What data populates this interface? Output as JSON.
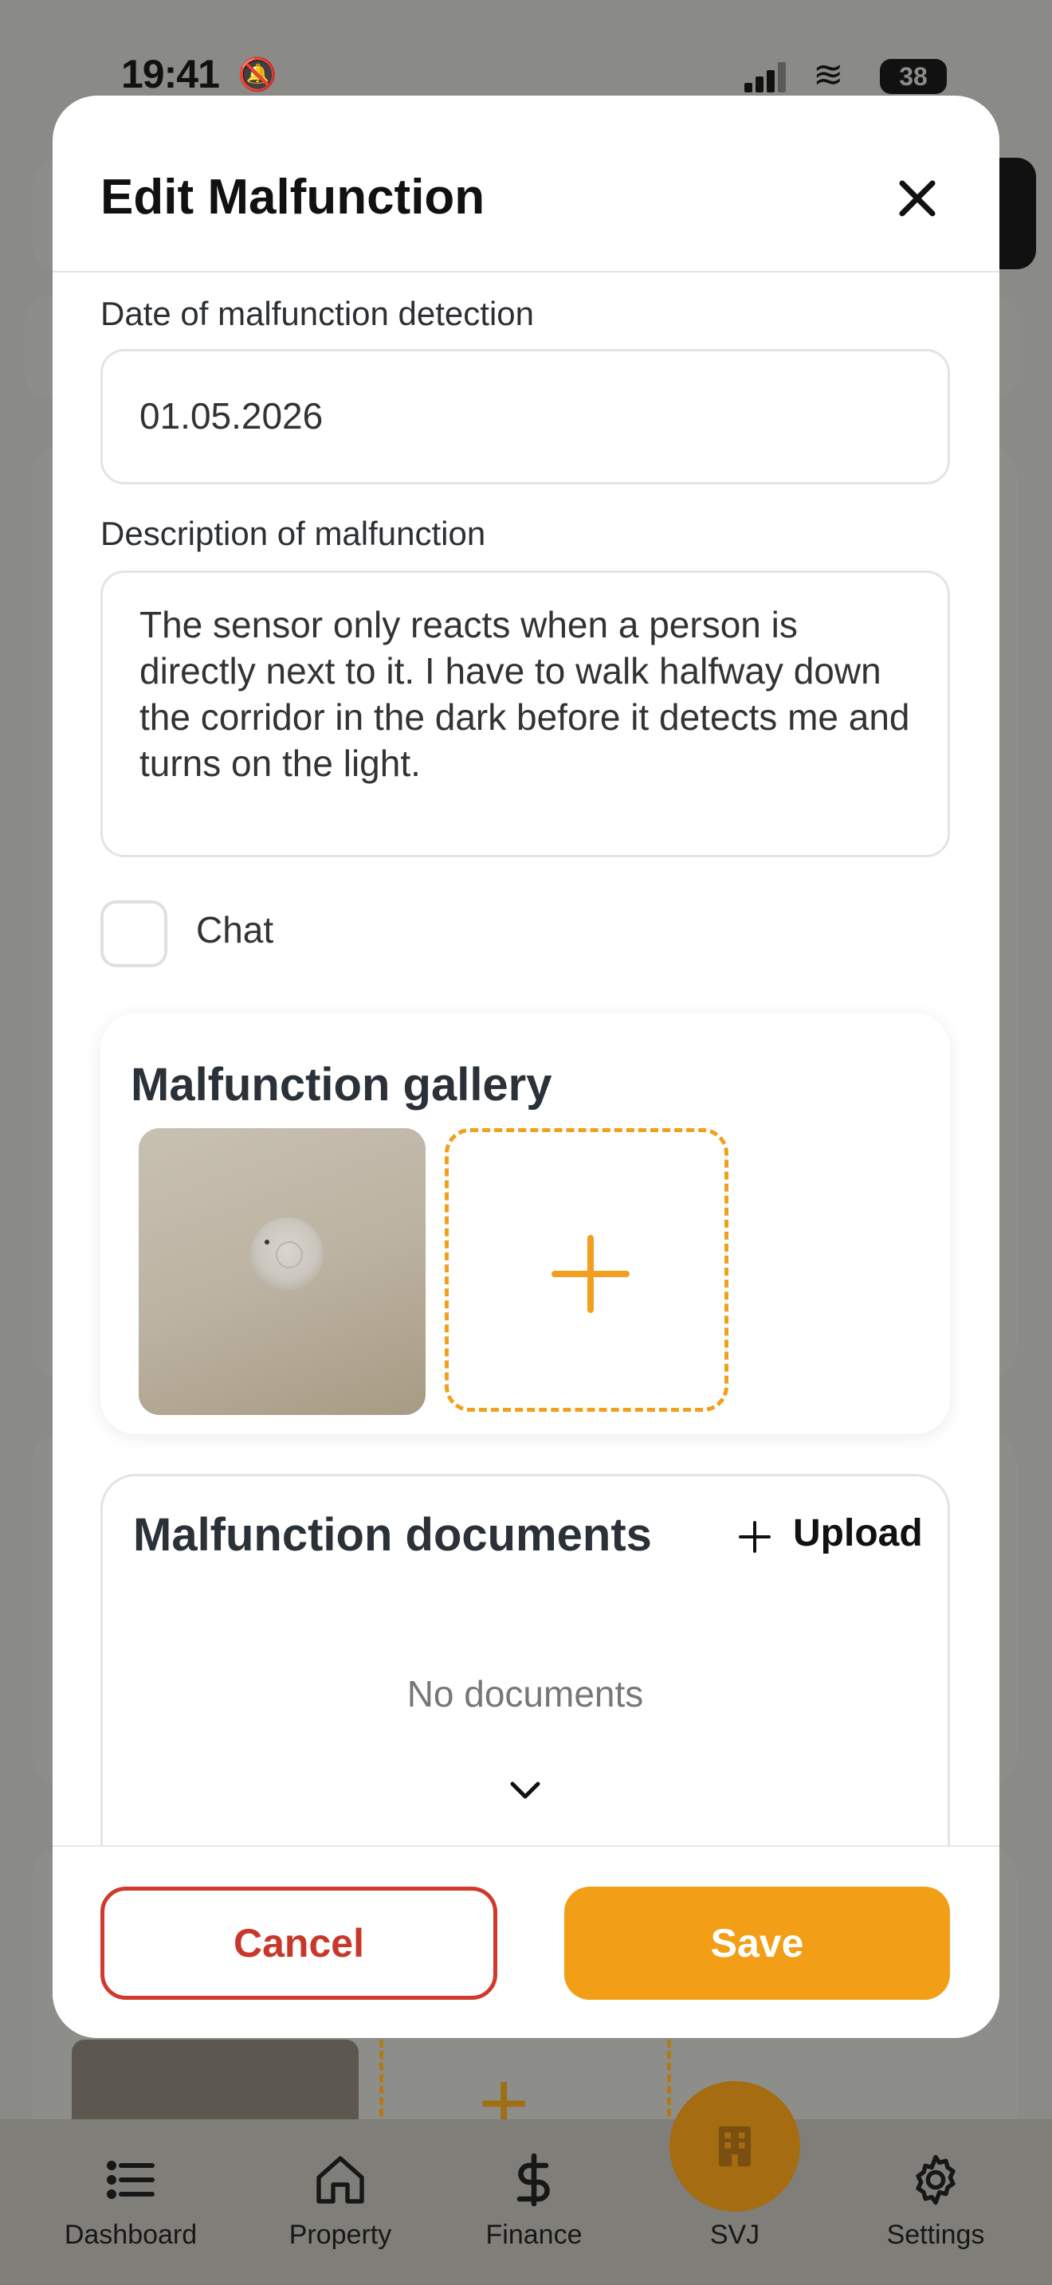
{
  "status_bar": {
    "time": "19:41",
    "battery": "38"
  },
  "modal": {
    "title": "Edit Malfunction",
    "date_label": "Date of malfunction detection",
    "date_value": "01.05.2026",
    "description_label": "Description of malfunction",
    "description_value": "The sensor only reacts when a person is directly next to it. I have to walk halfway down the corridor in the dark before it detects me and turns on the light.",
    "chat_label": "Chat",
    "chat_checked": false,
    "gallery": {
      "title": "Malfunction gallery"
    },
    "documents": {
      "title": "Malfunction documents",
      "upload_label": "Upload",
      "empty_text": "No documents"
    },
    "cancel_label": "Cancel",
    "save_label": "Save"
  },
  "tabbar": {
    "items": [
      {
        "label": "Dashboard",
        "icon": "list-icon"
      },
      {
        "label": "Property",
        "icon": "house-icon"
      },
      {
        "label": "Finance",
        "icon": "dollar-icon"
      },
      {
        "label": "SVJ",
        "icon": "building-icon"
      },
      {
        "label": "Settings",
        "icon": "gear-icon"
      }
    ]
  },
  "colors": {
    "accent": "#f29f17",
    "danger": "#d0392b",
    "overlay": "#8a8a86"
  }
}
